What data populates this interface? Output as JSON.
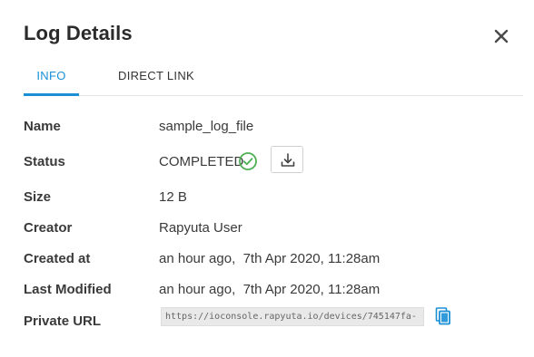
{
  "dialog": {
    "title": "Log Details"
  },
  "tabs": [
    {
      "label": "INFO",
      "active": true
    },
    {
      "label": "DIRECT LINK",
      "active": false
    }
  ],
  "details": {
    "name": {
      "label": "Name",
      "value": "sample_log_file"
    },
    "status": {
      "label": "Status",
      "value": "COMPLETED"
    },
    "size": {
      "label": "Size",
      "value": "12 B"
    },
    "creator": {
      "label": "Creator",
      "value": "Rapyuta User"
    },
    "created_at": {
      "label": "Created at",
      "value": "an hour ago,  7th Apr 2020, 11:28am"
    },
    "last_modified": {
      "label": "Last Modified",
      "value": "an hour ago,  7th Apr 2020, 11:28am"
    },
    "private_url": {
      "label": "Private URL",
      "value": "https://ioconsole.rapyuta.io/devices/745147fa-"
    }
  },
  "icons": {
    "close": "close-icon",
    "status": "check-circle-icon",
    "download": "download-icon",
    "copy": "copy-icon"
  },
  "colors": {
    "accent": "#1a8fd6",
    "success": "#4caf50",
    "text": "#3a3a3a"
  }
}
